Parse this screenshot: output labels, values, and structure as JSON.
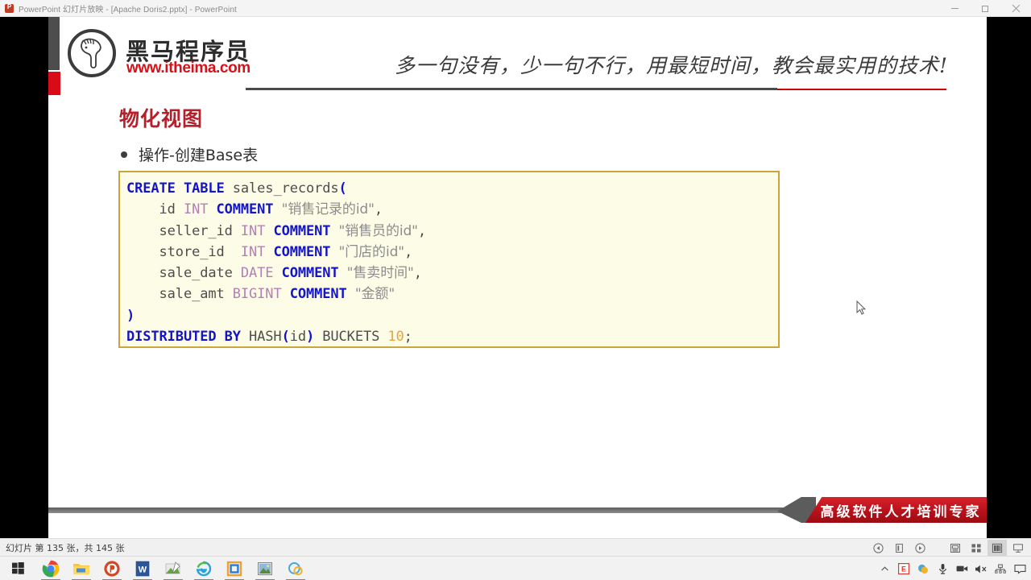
{
  "window": {
    "app_icon": "powerpoint-icon",
    "title": "PowerPoint 幻灯片放映 - [Apache Doris2.pptx] - PowerPoint",
    "minimize_label": "最小化",
    "restore_label": "还原",
    "close_label": "关闭"
  },
  "slide": {
    "logo": {
      "mark": "horse-head-icon",
      "brand_cn": "黑马程序员",
      "brand_url": "www.itheima.com"
    },
    "tagline": "多一句没有，少一句不行，用最短时间，教会最实用的技术!",
    "title": "物化视图",
    "bullet": "操作-创建Base表",
    "banner": "高级软件人才培训专家",
    "code_lines": [
      [
        {
          "t": "CREATE TABLE ",
          "c": "kw"
        },
        {
          "t": "sales_records",
          "c": "pl"
        },
        {
          "t": "(",
          "c": "kw"
        }
      ],
      [
        {
          "t": "    id ",
          "c": "pl"
        },
        {
          "t": "INT ",
          "c": "typ"
        },
        {
          "t": "COMMENT ",
          "c": "kw"
        },
        {
          "t": "\"销售记录的id\"",
          "c": "str"
        },
        {
          "t": ",",
          "c": "pl"
        }
      ],
      [
        {
          "t": "    seller_id ",
          "c": "pl"
        },
        {
          "t": "INT ",
          "c": "typ"
        },
        {
          "t": "COMMENT ",
          "c": "kw"
        },
        {
          "t": "\"销售员的id\"",
          "c": "str"
        },
        {
          "t": ",",
          "c": "pl"
        }
      ],
      [
        {
          "t": "    store_id  ",
          "c": "pl"
        },
        {
          "t": "INT ",
          "c": "typ"
        },
        {
          "t": "COMMENT ",
          "c": "kw"
        },
        {
          "t": "\"门店的id\"",
          "c": "str"
        },
        {
          "t": ",",
          "c": "pl"
        }
      ],
      [
        {
          "t": "    sale_date ",
          "c": "pl"
        },
        {
          "t": "DATE ",
          "c": "typ"
        },
        {
          "t": "COMMENT ",
          "c": "kw"
        },
        {
          "t": "\"售卖时间\"",
          "c": "str"
        },
        {
          "t": ",",
          "c": "pl"
        }
      ],
      [
        {
          "t": "    sale_amt ",
          "c": "pl"
        },
        {
          "t": "BIGINT ",
          "c": "typ"
        },
        {
          "t": "COMMENT ",
          "c": "kw"
        },
        {
          "t": "\"金额\"",
          "c": "str"
        }
      ],
      [
        {
          "t": ")",
          "c": "kw"
        }
      ],
      [
        {
          "t": "DISTRIBUTED BY ",
          "c": "kw"
        },
        {
          "t": "HASH",
          "c": "pl"
        },
        {
          "t": "(",
          "c": "kw"
        },
        {
          "t": "id",
          "c": "pl"
        },
        {
          "t": ")",
          "c": "kw"
        },
        {
          "t": " BUCKETS ",
          "c": "pl"
        },
        {
          "t": "10",
          "c": "num"
        },
        {
          "t": ";",
          "c": "pl"
        }
      ]
    ]
  },
  "statusbar": {
    "slide_counter": "幻灯片 第 135 张，共 145 张",
    "controls": [
      {
        "name": "previous-slide-button",
        "glyph": "◀"
      },
      {
        "name": "pen-tools-button",
        "glyph": "✎"
      },
      {
        "name": "next-slide-button",
        "glyph": "▶"
      },
      {
        "name": "notes-button",
        "glyph": "▤"
      },
      {
        "name": "all-slides-button",
        "glyph": "⊞"
      },
      {
        "name": "reading-view-button",
        "glyph": "⌸"
      },
      {
        "name": "presenter-view-button",
        "glyph": "⬒"
      }
    ]
  },
  "taskbar": {
    "start_label": "start-button",
    "items": [
      {
        "name": "taskbar-chrome",
        "label": "Google Chrome"
      },
      {
        "name": "taskbar-file-explorer",
        "label": "文件资源管理器"
      },
      {
        "name": "taskbar-powerpoint",
        "label": "PowerPoint"
      },
      {
        "name": "taskbar-word",
        "label": "Word"
      },
      {
        "name": "taskbar-snipaste",
        "label": "截图工具"
      },
      {
        "name": "taskbar-internet-explorer",
        "label": "Internet Explorer"
      },
      {
        "name": "taskbar-vmware",
        "label": "VMware Workstation"
      },
      {
        "name": "taskbar-photo-viewer",
        "label": "看图工具"
      },
      {
        "name": "taskbar-qq",
        "label": "QQ"
      }
    ],
    "tray": [
      {
        "name": "show-hidden-icons-icon",
        "glyph": "⌃"
      },
      {
        "name": "sogou-input-icon",
        "glyph": "E"
      },
      {
        "name": "tray-app-icon",
        "glyph": "◕"
      },
      {
        "name": "microphone-icon",
        "glyph": "Ἲ4"
      },
      {
        "name": "camera-icon",
        "glyph": "▬"
      },
      {
        "name": "volume-muted-icon",
        "glyph": "ὐ7"
      },
      {
        "name": "network-icon",
        "glyph": "⬚"
      },
      {
        "name": "action-center-icon",
        "glyph": "▭"
      }
    ]
  },
  "colors": {
    "brand_red": "#d4121a",
    "title_red": "#b5202b",
    "code_bg": "#fdfde7",
    "code_border": "#caa63a",
    "keyword_blue": "#1414c8",
    "type_purple": "#b47fb4",
    "string_gray": "#8c8c8c",
    "number_orange": "#e8a33d",
    "banner_red": "#b8111a"
  }
}
